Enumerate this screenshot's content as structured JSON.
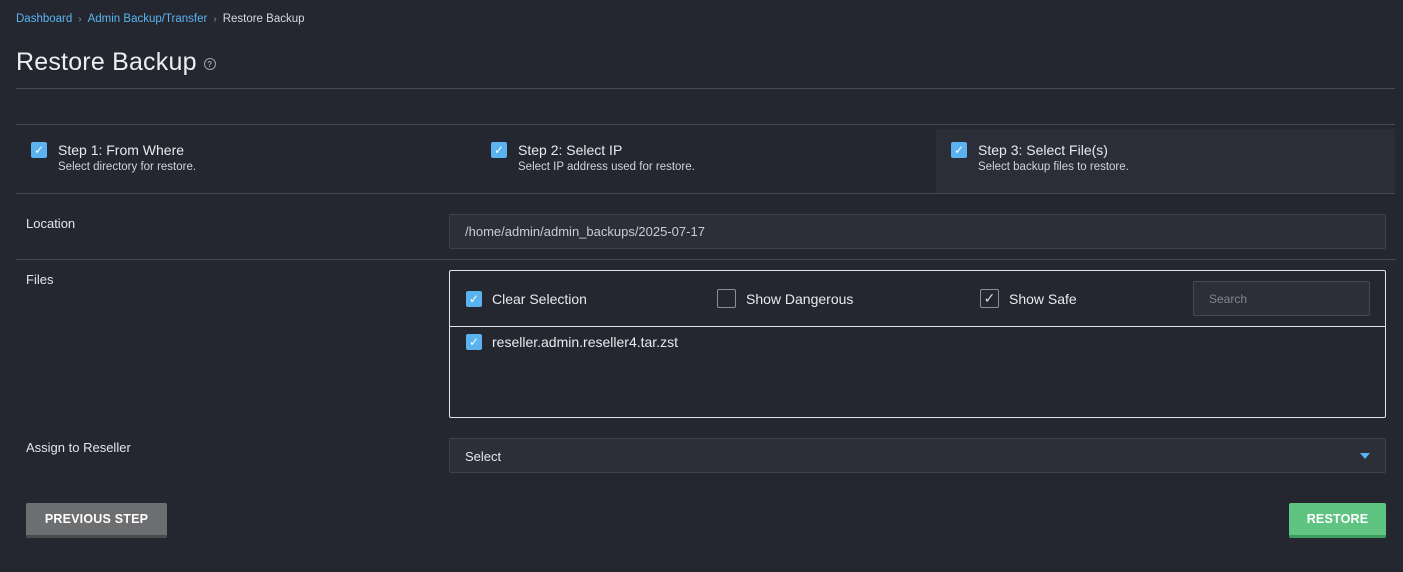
{
  "breadcrumb": {
    "items": [
      "Dashboard",
      "Admin Backup/Transfer"
    ],
    "current": "Restore Backup",
    "separator": "›"
  },
  "page": {
    "title": "Restore Backup",
    "help_icon": "?"
  },
  "steps": [
    {
      "title": "Step 1: From Where",
      "desc": "Select directory for restore.",
      "checked": true
    },
    {
      "title": "Step 2: Select IP",
      "desc": "Select IP address used for restore.",
      "checked": true
    },
    {
      "title": "Step 3: Select File(s)",
      "desc": "Select backup files to restore.",
      "checked": true,
      "active": true
    }
  ],
  "form": {
    "location_label": "Location",
    "location_value": "/home/admin/admin_backups/2025-07-17",
    "files_label": "Files",
    "files": {
      "clear_selection": "Clear Selection",
      "show_dangerous": "Show Dangerous",
      "show_safe": "Show Safe",
      "search_placeholder": "Search",
      "list": [
        "reseller.admin.reseller4.tar.zst"
      ]
    },
    "reseller_label": "Assign to Reseller",
    "reseller_value": "Select"
  },
  "buttons": {
    "previous": "PREVIOUS STEP",
    "restore": "RESTORE"
  },
  "icons": {
    "check": "✓"
  },
  "colors": {
    "accent": "#5ab2ee",
    "link": "#5bb4f0",
    "success": "#5fc482",
    "background": "#242730"
  }
}
